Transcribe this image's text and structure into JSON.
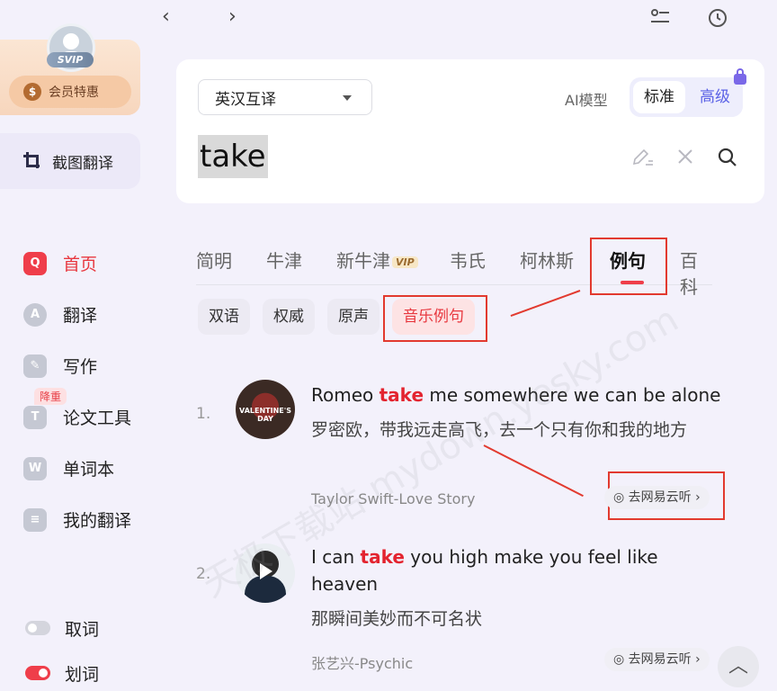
{
  "nav_buttons": {
    "back": "‹",
    "forward": "›"
  },
  "sidebar": {
    "svip_badge": "SVIP",
    "member_button": "会员特惠",
    "coin_symbol": "$",
    "screenshot_translate": "截图翻译",
    "items": [
      {
        "label": "首页",
        "icon": "home-icon",
        "glyph": "Q",
        "active": true
      },
      {
        "label": "翻译",
        "icon": "translate-icon",
        "glyph": "A"
      },
      {
        "label": "写作",
        "icon": "pen-icon",
        "glyph": "✎"
      },
      {
        "label": "论文工具",
        "icon": "paper-icon",
        "glyph": "T",
        "badge": "降重"
      },
      {
        "label": "单词本",
        "icon": "wordbook-icon",
        "glyph": "W"
      },
      {
        "label": "我的翻译",
        "icon": "my-translation-icon",
        "glyph": "≡"
      }
    ],
    "toggles": [
      {
        "label": "取词",
        "on": false
      },
      {
        "label": "划词",
        "on": true
      }
    ]
  },
  "search": {
    "language_mode": "英汉互译",
    "ai_model_label": "AI模型",
    "mode_standard": "标准",
    "mode_advanced": "高级",
    "query": "take"
  },
  "tabs": [
    {
      "label": "简明"
    },
    {
      "label": "牛津"
    },
    {
      "label": "新牛津",
      "tag": "VIP"
    },
    {
      "label": "韦氏"
    },
    {
      "label": "柯林斯"
    },
    {
      "label": "例句",
      "active": true
    },
    {
      "label": "百科"
    }
  ],
  "chips": [
    {
      "label": "双语"
    },
    {
      "label": "权威"
    },
    {
      "label": "原声"
    },
    {
      "label": "音乐例句",
      "active": true
    }
  ],
  "examples": [
    {
      "number": "1.",
      "sentence_before": "Romeo ",
      "keyword": "take",
      "sentence_after": " me somewhere we can be alone",
      "translation": "罗密欧，带我远走高飞，去一个只有你和我的地方",
      "source": "Taylor Swift-Love Story",
      "listen": "去网易云听",
      "thumb_text": "VALENTINE'S DAY"
    },
    {
      "number": "2.",
      "sentence_before": "I can ",
      "keyword": "take",
      "sentence_after": " you high make you feel like heaven",
      "translation": "那瞬间美妙而不可名状",
      "source": "张艺兴-Psychic",
      "listen": "去网易云听"
    }
  ],
  "watermark": "天极下载站 mydown.yesky.com",
  "colors": {
    "accent": "#ef3e4a",
    "brand_blue": "#5b62e6",
    "annotation_red": "#e23a2f"
  }
}
